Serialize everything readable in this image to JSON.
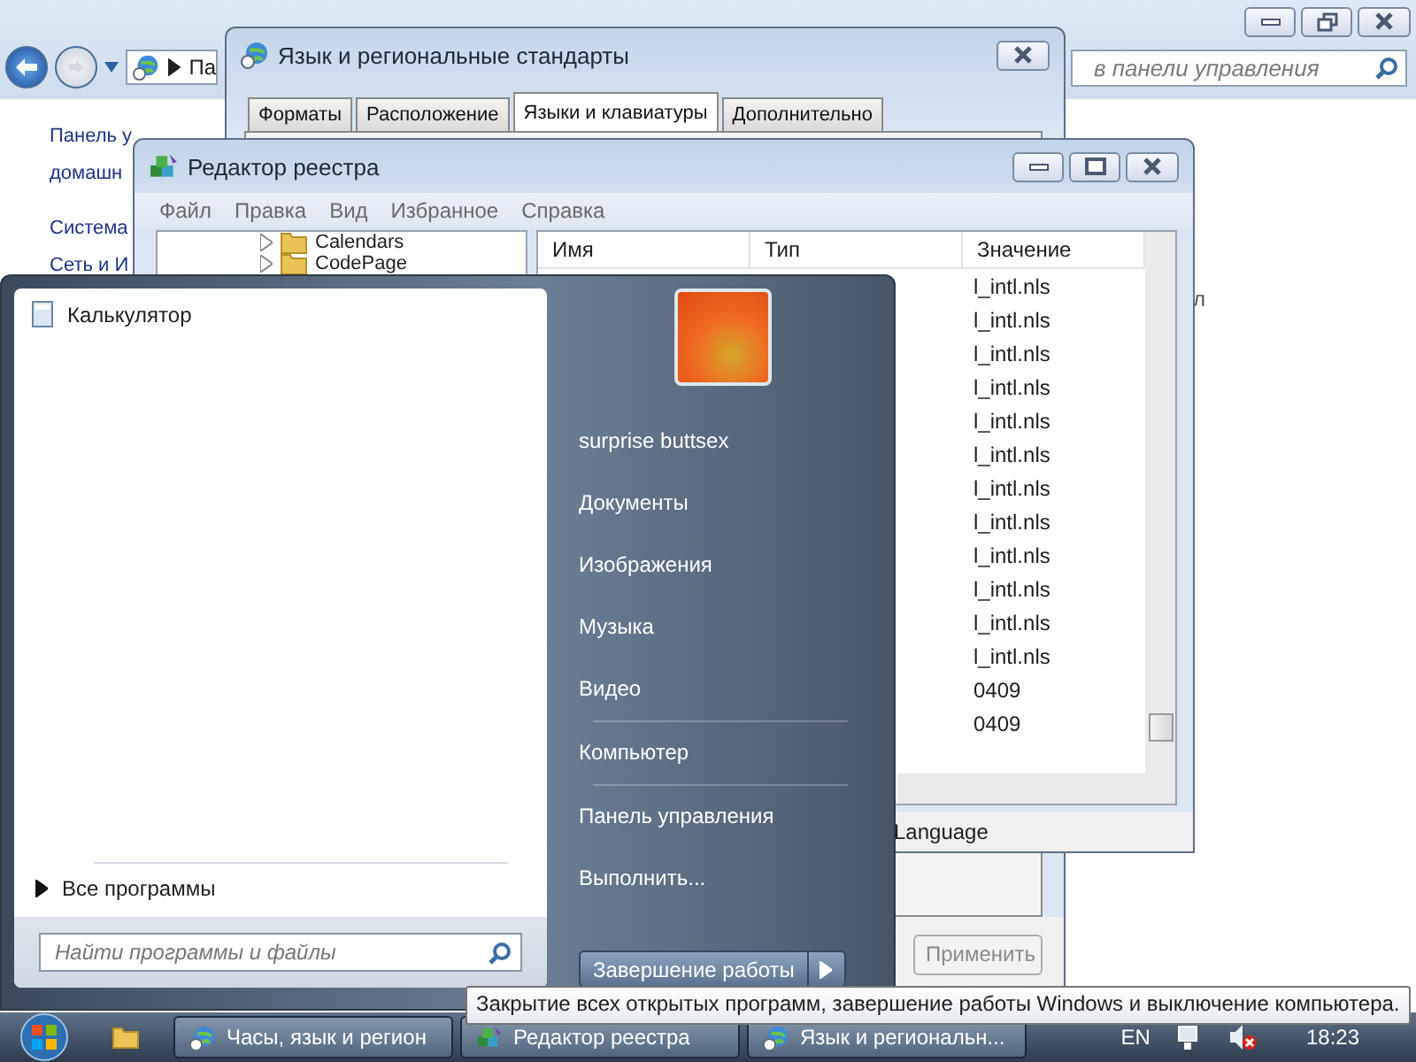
{
  "control_panel": {
    "address": "Па",
    "search_placeholder": "в панели управления",
    "links": [
      "Панель у",
      "домашн",
      "Система",
      "Сеть и И"
    ],
    "text_fragment": "л"
  },
  "region_dialog": {
    "title": "Язык и региональные стандарты",
    "tabs": [
      {
        "label": "Форматы",
        "selected": false
      },
      {
        "label": "Расположение",
        "selected": false
      },
      {
        "label": "Языки и клавиатуры",
        "selected": true
      },
      {
        "label": "Дополнительно",
        "selected": false
      }
    ],
    "apply_button": "Применить"
  },
  "registry_editor": {
    "title": "Редактор реестра",
    "menu": [
      "Файл",
      "Правка",
      "Вид",
      "Избранное",
      "Справка"
    ],
    "tree": [
      "Calendars",
      "CodePage"
    ],
    "columns": [
      "Имя",
      "Тип",
      "Значение"
    ],
    "rows": [
      {
        "value": "l_intl.nls"
      },
      {
        "value": "l_intl.nls"
      },
      {
        "value": "l_intl.nls"
      },
      {
        "value": "l_intl.nls"
      },
      {
        "value": "l_intl.nls"
      },
      {
        "value": "l_intl.nls"
      },
      {
        "value": "l_intl.nls"
      },
      {
        "value": "l_intl.nls"
      },
      {
        "value": "l_intl.nls"
      },
      {
        "value": "l_intl.nls"
      },
      {
        "value": "l_intl.nls"
      },
      {
        "value": "l_intl.nls"
      },
      {
        "value": "0409"
      },
      {
        "value": "0409"
      }
    ],
    "status_bar": "Language"
  },
  "start_menu": {
    "programs": [
      "Калькулятор"
    ],
    "all_programs": "Все программы",
    "search_placeholder": "Найти программы и файлы",
    "user_name": "surprise buttsex",
    "places": [
      {
        "label": "Документы",
        "separator_before": false
      },
      {
        "label": "Изображения",
        "separator_before": false
      },
      {
        "label": "Музыка",
        "separator_before": false
      },
      {
        "label": "Видео",
        "separator_before": false
      },
      {
        "label": "Компьютер",
        "separator_before": true
      },
      {
        "label": "Панель управления",
        "separator_before": true
      },
      {
        "label": "Выполнить...",
        "separator_before": false
      }
    ],
    "shutdown_button": "Завершение работы"
  },
  "tooltip": "Закрытие всех открытых программ, завершение работы Windows и выключение компьютера.",
  "taskbar": {
    "tasks": [
      {
        "label": "Часы, язык и регион",
        "kind": "globe"
      },
      {
        "label": "Редактор реестра",
        "kind": "registry"
      },
      {
        "label": "Язык и региональн...",
        "kind": "globe"
      }
    ],
    "language": "EN",
    "clock": "18:23"
  }
}
